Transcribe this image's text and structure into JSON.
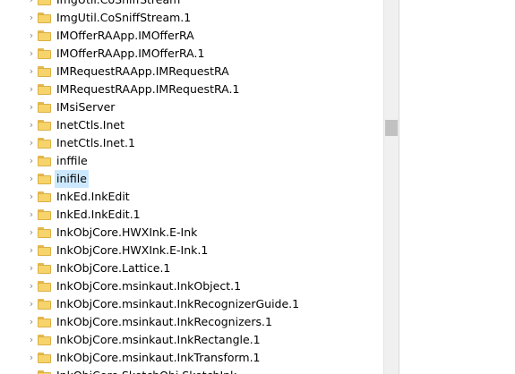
{
  "tree": {
    "items": [
      {
        "label": "ImgUtil.CoSniffStream",
        "selected": false
      },
      {
        "label": "ImgUtil.CoSniffStream.1",
        "selected": false
      },
      {
        "label": "IMOfferRAApp.IMOfferRA",
        "selected": false
      },
      {
        "label": "IMOfferRAApp.IMOfferRA.1",
        "selected": false
      },
      {
        "label": "IMRequestRAApp.IMRequestRA",
        "selected": false
      },
      {
        "label": "IMRequestRAApp.IMRequestRA.1",
        "selected": false
      },
      {
        "label": "IMsiServer",
        "selected": false
      },
      {
        "label": "InetCtls.Inet",
        "selected": false
      },
      {
        "label": "InetCtls.Inet.1",
        "selected": false
      },
      {
        "label": "inffile",
        "selected": false
      },
      {
        "label": "inifile",
        "selected": true
      },
      {
        "label": "InkEd.InkEdit",
        "selected": false
      },
      {
        "label": "InkEd.InkEdit.1",
        "selected": false
      },
      {
        "label": "InkObjCore.HWXInk.E-Ink",
        "selected": false
      },
      {
        "label": "InkObjCore.HWXInk.E-Ink.1",
        "selected": false
      },
      {
        "label": "InkObjCore.Lattice.1",
        "selected": false
      },
      {
        "label": "InkObjCore.msinkaut.InkObject.1",
        "selected": false
      },
      {
        "label": "InkObjCore.msinkaut.InkRecognizerGuide.1",
        "selected": false
      },
      {
        "label": "InkObjCore.msinkaut.InkRecognizers.1",
        "selected": false
      },
      {
        "label": "InkObjCore.msinkaut.InkRectangle.1",
        "selected": false
      },
      {
        "label": "InkObjCore.msinkaut.InkTransform.1",
        "selected": false
      },
      {
        "label": "InkObjCore.SketchObj.SketchInk",
        "selected": false
      }
    ],
    "expand_glyph": "›",
    "icons": {
      "expand": "chevron-right-icon",
      "node": "folder-icon"
    }
  },
  "colors": {
    "selection": "#cce8ff",
    "folder": "#f6d46b",
    "scrollbar_track": "#f0f0f0",
    "scrollbar_thumb": "#c1c1c1"
  }
}
